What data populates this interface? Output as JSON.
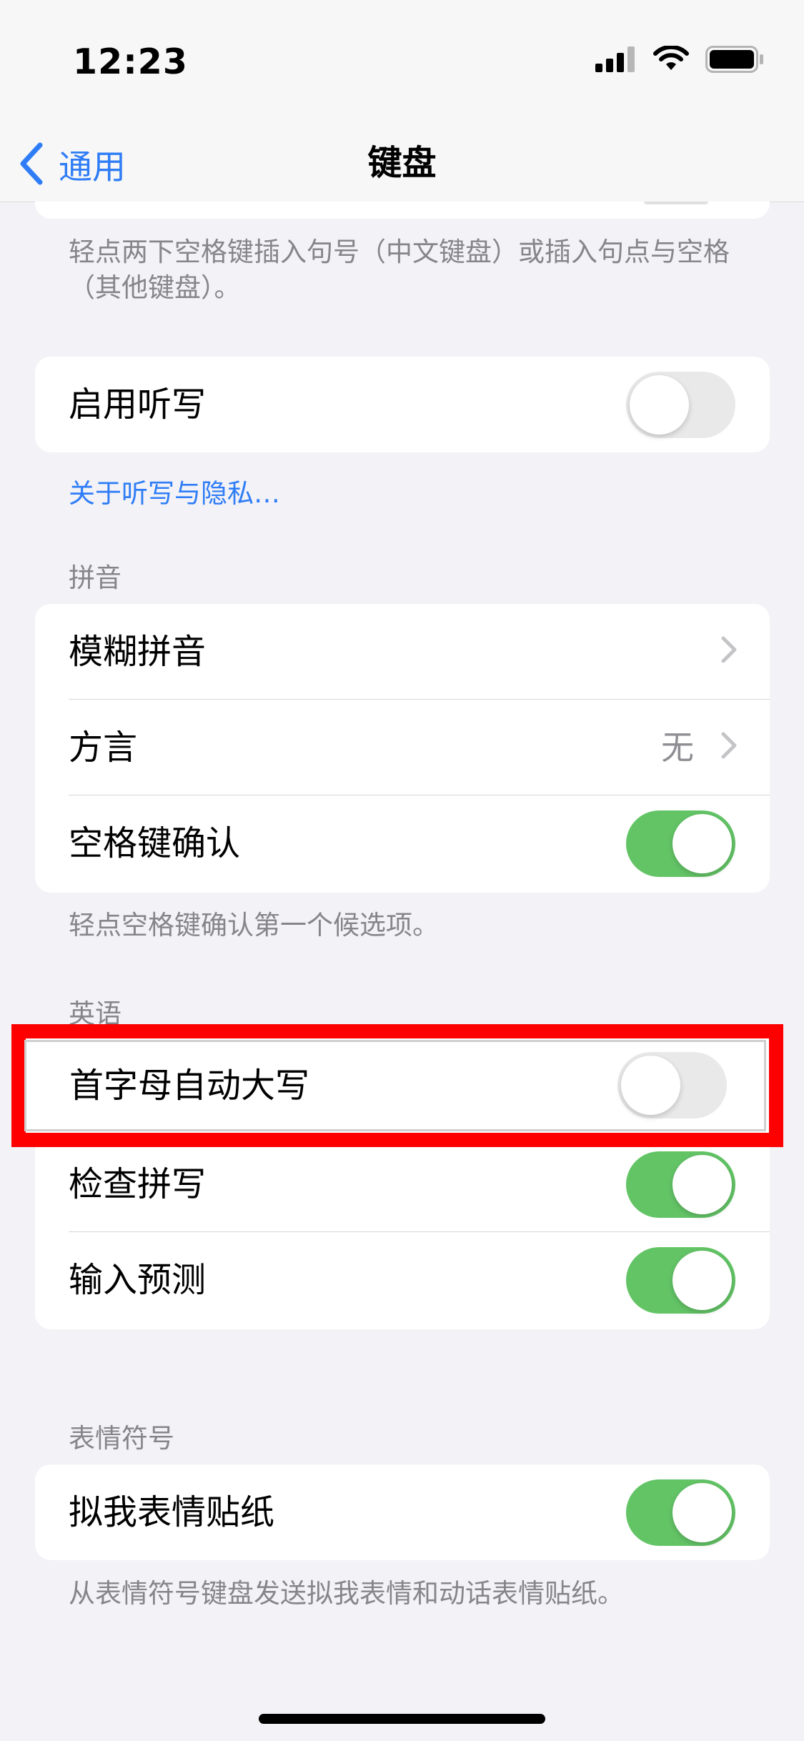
{
  "status": {
    "time": "12:23"
  },
  "nav": {
    "back_label": "通用",
    "title": "键盘"
  },
  "top_footnote": "轻点两下空格键插入句号（中文键盘）或插入句点与空格（其他键盘）。",
  "dictation": {
    "label": "启用听写",
    "on": false,
    "link": "关于听写与隐私…"
  },
  "pinyin": {
    "header": "拼音",
    "items": [
      {
        "label": "模糊拼音",
        "type": "chevron"
      },
      {
        "label": "方言",
        "type": "chevron",
        "value": "无"
      },
      {
        "label": "空格键确认",
        "type": "toggle",
        "on": true
      }
    ],
    "footnote": "轻点空格键确认第一个候选项。"
  },
  "english": {
    "header": "英语",
    "items": [
      {
        "label": "首字母自动大写",
        "type": "toggle",
        "on": false
      },
      {
        "label": "检查拼写",
        "type": "toggle",
        "on": true
      },
      {
        "label": "输入预测",
        "type": "toggle",
        "on": true
      }
    ]
  },
  "emoji": {
    "header": "表情符号",
    "items": [
      {
        "label": "拟我表情贴纸",
        "type": "toggle",
        "on": true
      }
    ],
    "footnote": "从表情符号键盘发送拟我表情和动话表情贴纸。"
  },
  "colors": {
    "accent": "#2f7df6",
    "toggle_on": "#63c466",
    "highlight": "#ff0000"
  }
}
